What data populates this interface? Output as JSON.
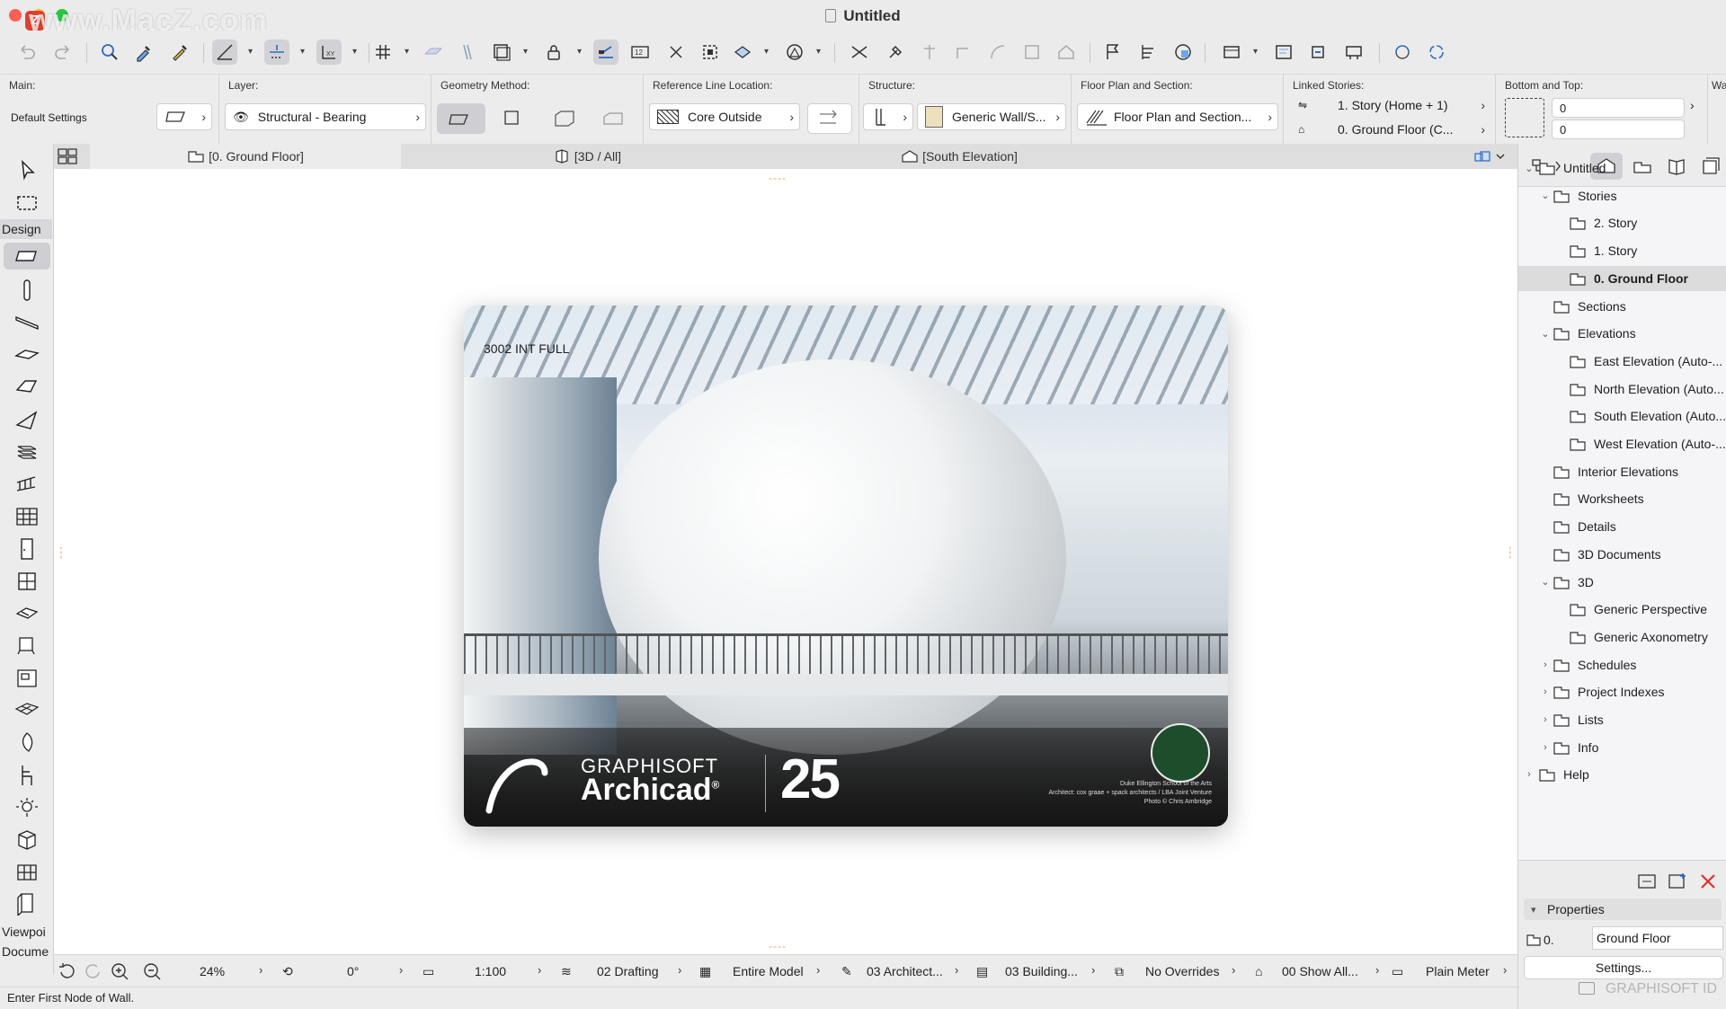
{
  "window": {
    "title": "Untitled",
    "watermark": "www.MacZ.com",
    "watermark_badge": "Z"
  },
  "infobox": {
    "main": {
      "label": "Main:",
      "value": "Default Settings"
    },
    "layer": {
      "label": "Layer:",
      "value": "Structural - Bearing"
    },
    "geometry": {
      "label": "Geometry Method:"
    },
    "refline": {
      "label": "Reference Line Location:",
      "value": "Core Outside"
    },
    "structure": {
      "label": "Structure:",
      "value": "Generic Wall/S..."
    },
    "floorplan": {
      "label": "Floor Plan and Section:",
      "value": "Floor Plan and Section..."
    },
    "linked": {
      "label": "Linked Stories:",
      "top": "1. Story (Home + 1)",
      "bottom": "0. Ground Floor (C..."
    },
    "bottomtop": {
      "label": "Bottom and Top:",
      "top_value": "0",
      "bottom_value": "0"
    },
    "overflow_label": "Wa"
  },
  "toolbox": {
    "groups": [
      "Design",
      "Viewpoi",
      "Docume"
    ]
  },
  "tabs": [
    {
      "label": "[0. Ground Floor]",
      "icon": "floor-plan-icon"
    },
    {
      "label": "[3D / All]",
      "icon": "3d-icon"
    },
    {
      "label": "[South Elevation]",
      "icon": "elevation-icon"
    }
  ],
  "splash": {
    "code": "3002 INT FULL",
    "company": "GRAPHISOFT",
    "product": "Archicad",
    "registered": "®",
    "version": "25",
    "credit_line1": "Duke Ellington School of the Arts",
    "credit_line2": "Architect: cox graae + spack architects / LBA Joint Venture",
    "credit_line3": "Photo © Chris Ambridge"
  },
  "bottombar": {
    "zoom": "24%",
    "angle": "0°",
    "scale": "1:100",
    "layer_combo": "02 Drafting",
    "model_view": "Entire Model",
    "pen_set": "03 Architect...",
    "mvo": "03 Building...",
    "overrides": "No Overrides",
    "renovation": "00 Show All...",
    "dimension": "Plain Meter"
  },
  "status_text": "Enter First Node of Wall.",
  "navigator": {
    "items": [
      {
        "label": "Untitled",
        "level": 0,
        "disc": "open",
        "icon": "project-icon"
      },
      {
        "label": "Stories",
        "level": 1,
        "disc": "open",
        "icon": "stories-icon"
      },
      {
        "label": "2. Story",
        "level": 2,
        "disc": "",
        "icon": "story-icon"
      },
      {
        "label": "1. Story",
        "level": 2,
        "disc": "",
        "icon": "story-icon"
      },
      {
        "label": "0. Ground Floor",
        "level": 2,
        "disc": "",
        "icon": "story-icon",
        "selected": true
      },
      {
        "label": "Sections",
        "level": 1,
        "disc": "",
        "icon": "section-icon"
      },
      {
        "label": "Elevations",
        "level": 1,
        "disc": "open",
        "icon": "elevation-icon"
      },
      {
        "label": "East Elevation (Auto-...",
        "level": 2,
        "disc": "",
        "icon": "elevation-icon"
      },
      {
        "label": "North Elevation (Auto...",
        "level": 2,
        "disc": "",
        "icon": "elevation-icon"
      },
      {
        "label": "South Elevation (Auto...",
        "level": 2,
        "disc": "",
        "icon": "elevation-icon"
      },
      {
        "label": "West Elevation (Auto-...",
        "level": 2,
        "disc": "",
        "icon": "elevation-icon"
      },
      {
        "label": "Interior Elevations",
        "level": 1,
        "disc": "",
        "icon": "interior-elevation-icon"
      },
      {
        "label": "Worksheets",
        "level": 1,
        "disc": "",
        "icon": "worksheet-icon"
      },
      {
        "label": "Details",
        "level": 1,
        "disc": "",
        "icon": "detail-icon"
      },
      {
        "label": "3D Documents",
        "level": 1,
        "disc": "",
        "icon": "3d-document-icon"
      },
      {
        "label": "3D",
        "level": 1,
        "disc": "open",
        "icon": "3d-icon"
      },
      {
        "label": "Generic Perspective",
        "level": 2,
        "disc": "",
        "icon": "perspective-icon"
      },
      {
        "label": "Generic Axonometry",
        "level": 2,
        "disc": "",
        "icon": "axonometry-icon"
      },
      {
        "label": "Schedules",
        "level": 1,
        "disc": "closed",
        "icon": "schedule-icon"
      },
      {
        "label": "Project Indexes",
        "level": 1,
        "disc": "closed",
        "icon": "index-icon"
      },
      {
        "label": "Lists",
        "level": 1,
        "disc": "closed",
        "icon": "list-icon"
      },
      {
        "label": "Info",
        "level": 1,
        "disc": "closed",
        "icon": "info-icon"
      },
      {
        "label": "Help",
        "level": 0,
        "disc": "closed",
        "icon": "help-icon"
      }
    ],
    "properties_label": "Properties",
    "properties_id": "0.",
    "properties_name": "Ground Floor",
    "settings_label": "Settings...",
    "graphisoft_id": "GRAPHISOFT ID"
  },
  "colors": {
    "close": "#ff5f57",
    "minimize": "#febc2e",
    "maximize": "#28c840",
    "delete_accent": "#e0302a",
    "marker": "#f0a060"
  }
}
